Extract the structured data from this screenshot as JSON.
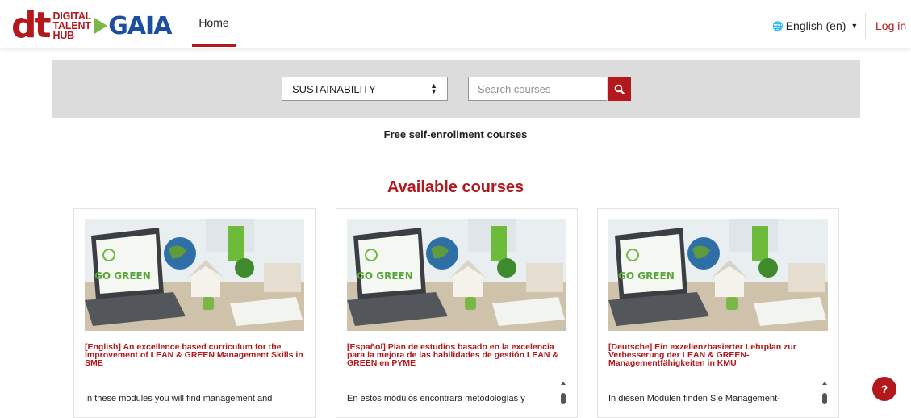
{
  "header": {
    "logo_dt": "dt",
    "logo_lines": [
      "DIGITAL",
      "TALENT",
      "HUB"
    ],
    "logo_gaia": "GAIA",
    "nav_home": "Home",
    "language": "English (en)",
    "login": "Log in"
  },
  "search": {
    "category": "SUSTAINABILITY",
    "placeholder": "Search courses"
  },
  "section_title": "Free self-enrollment courses",
  "available_title": "Available courses",
  "courses": [
    {
      "title": "[English] An excellence based curriculum for the Improvement of LEAN & GREEN Management Skills in SME",
      "description": "In these modules you will find management and",
      "image_text": "GO GREEN"
    },
    {
      "title": "[Español] Plan de estudios basado en la excelencia para la mejora de las habilidades de gestión LEAN & GREEN en PYME",
      "description": "En estos módulos encontrará metodologías y",
      "image_text": "GO GREEN"
    },
    {
      "title": "[Deutsche] Ein exzellenzbasierter Lehrplan zur Verbesserung der LEAN & GREEN-Managementfähigkeiten in KMU",
      "description": "In diesen Modulen finden Sie Management-",
      "image_text": "GO GREEN"
    }
  ],
  "help_label": "?",
  "colors": {
    "brand_red": "#b3181c",
    "gaia_blue": "#1d4fa0",
    "leaf_green": "#7ab648"
  }
}
